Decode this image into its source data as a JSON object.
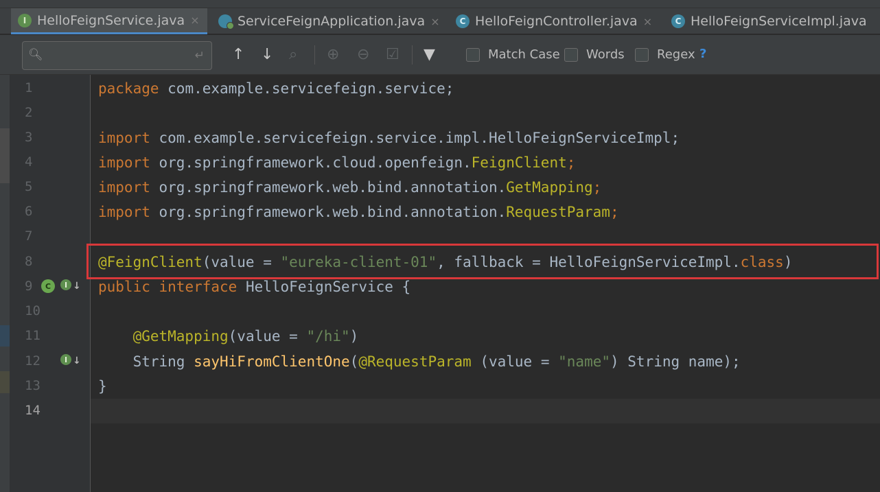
{
  "tabs": [
    {
      "label": "HelloFeignService.java",
      "icon": "interface-icon",
      "glyph": "I",
      "active": true
    },
    {
      "label": "ServiceFeignApplication.java",
      "icon": "spring-app-icon",
      "glyph": "",
      "active": false
    },
    {
      "label": "HelloFeignController.java",
      "icon": "class-icon",
      "glyph": "C",
      "active": false
    },
    {
      "label": "HelloFeignServiceImpl.java",
      "icon": "class-icon",
      "glyph": "C",
      "active": false
    }
  ],
  "tab_close_glyph": "×",
  "findbar": {
    "search_value": "",
    "match_case_label": "Match Case",
    "words_label": "Words",
    "regex_label": "Regex",
    "help_label": "?"
  },
  "line_numbers": [
    "1",
    "2",
    "3",
    "4",
    "5",
    "6",
    "7",
    "8",
    "9",
    "10",
    "11",
    "12",
    "13",
    "14"
  ],
  "code": {
    "l1_kw": "package",
    "l1_rest": " com.example.servicefeign.service;",
    "l3_kw": "import",
    "l3_rest": " com.example.servicefeign.service.impl.HelloFeignServiceImpl;",
    "l4_kw": "import",
    "l4_pkg": " org.springframework.cloud.openfeign.",
    "l4_cls": "FeignClient",
    "l4_end": ";",
    "l5_kw": "import",
    "l5_pkg": " org.springframework.web.bind.annotation.",
    "l5_cls": "GetMapping",
    "l5_end": ";",
    "l6_kw": "import",
    "l6_pkg": " org.springframework.web.bind.annotation.",
    "l6_cls": "RequestParam",
    "l6_end": ";",
    "l8_ann": "@FeignClient",
    "l8_a": "(value = ",
    "l8_str": "\"eureka-client-01\"",
    "l8_b": ", fallback = HelloFeignServiceImpl.",
    "l8_kw": "class",
    "l8_c": ")",
    "l9_kw1": "public",
    "l9_kw2": "interface",
    "l9_rest": " HelloFeignService {",
    "l11_ann": "@GetMapping",
    "l11_a": "(value = ",
    "l11_str": "\"/hi\"",
    "l11_b": ")",
    "l12_a": "String ",
    "l12_fn": "sayHiFromClientOne",
    "l12_b": "(",
    "l12_ann": "@RequestParam",
    "l12_c": " (value = ",
    "l12_str": "\"name\"",
    "l12_d": ") String name);",
    "l13": "}"
  },
  "colors": {
    "highlight_box": "#d9383a",
    "keyword": "#cc7832",
    "string": "#6a8759",
    "annotation": "#bbb529",
    "method": "#ffc66d"
  }
}
